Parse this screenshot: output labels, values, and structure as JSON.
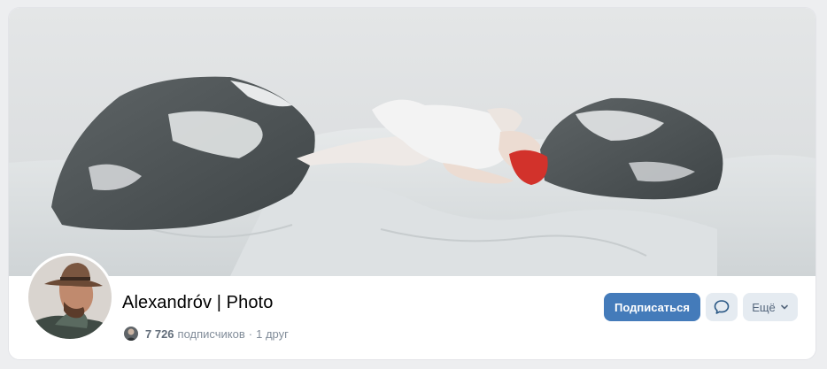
{
  "profile": {
    "name": "Alexandróv | Photo",
    "followers_count": "7 726",
    "followers_label": "подписчиков",
    "separator": "·",
    "friends": "1 друг"
  },
  "actions": {
    "subscribe_label": "Подписаться",
    "message_icon": "message-bubble-icon",
    "more_label": "Ещё",
    "more_icon": "chevron-down-icon"
  },
  "colors": {
    "page_bg": "#edeef0",
    "primary_button": "#447bba",
    "secondary_button": "#e5ebf1",
    "secondary_text": "#818c99"
  }
}
